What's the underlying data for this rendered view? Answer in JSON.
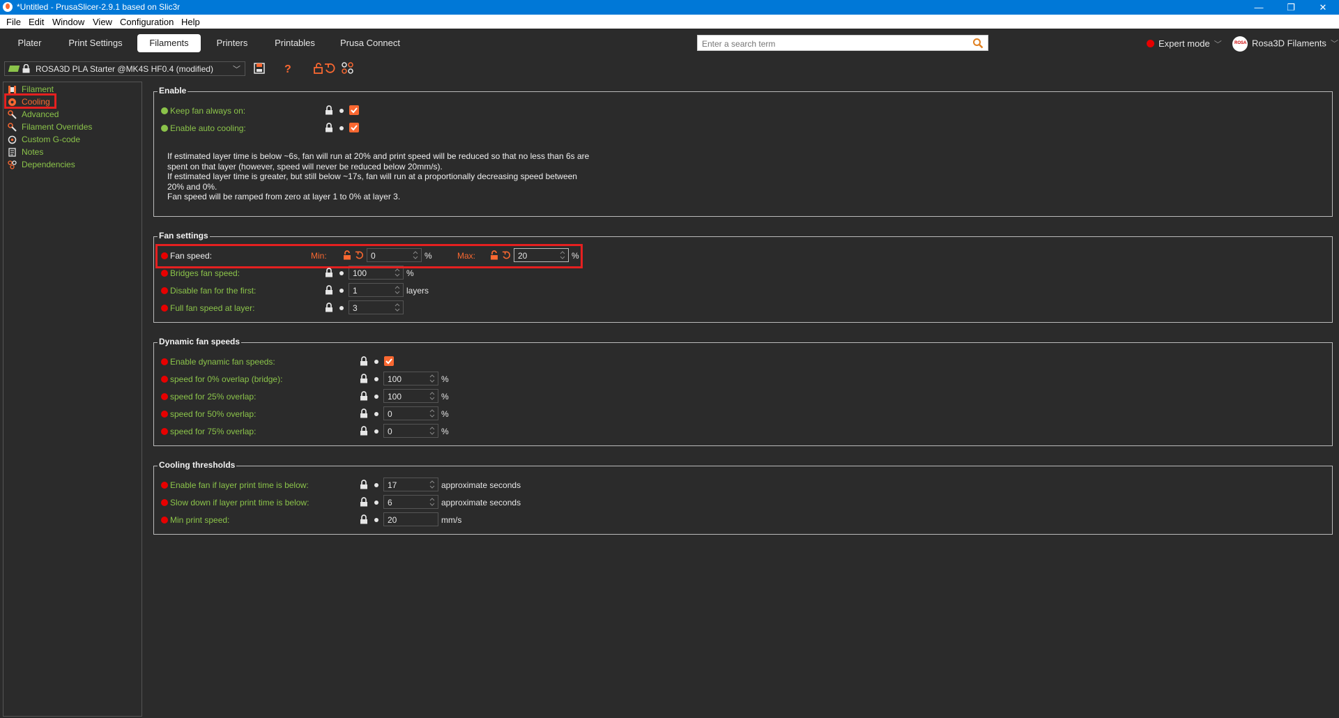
{
  "window": {
    "title": "*Untitled - PrusaSlicer-2.9.1 based on Slic3r",
    "minimize": "—",
    "restore": "❐",
    "close": "✕"
  },
  "menu": [
    "File",
    "Edit",
    "Window",
    "View",
    "Configuration",
    "Help"
  ],
  "tabs": [
    "Plater",
    "Print Settings",
    "Filaments",
    "Printers",
    "Printables",
    "Prusa Connect"
  ],
  "active_tab": "Filaments",
  "search": {
    "placeholder": "Enter a search term",
    "value": ""
  },
  "mode": {
    "label": "Expert mode",
    "color": "#e70000"
  },
  "account": {
    "label": "Rosa3D Filaments"
  },
  "preset": {
    "name": "ROSA3D PLA Starter @MK4S HF0.4 (modified)"
  },
  "sidebar": {
    "items": [
      {
        "label": "Filament",
        "icon": "spool-icon"
      },
      {
        "label": "Cooling",
        "icon": "fan-icon"
      },
      {
        "label": "Advanced",
        "icon": "wrench-icon"
      },
      {
        "label": "Filament Overrides",
        "icon": "wrench-icon"
      },
      {
        "label": "Custom G-code",
        "icon": "gcode-icon"
      },
      {
        "label": "Notes",
        "icon": "notes-icon"
      },
      {
        "label": "Dependencies",
        "icon": "dependencies-icon"
      }
    ],
    "active": "Cooling"
  },
  "groups": {
    "enable": {
      "title": "Enable",
      "keep_fan_label": "Keep fan always on:",
      "auto_cooling_label": "Enable auto cooling:",
      "description": [
        "If estimated layer time is below ~6s, fan will run at 20% and print speed will be reduced so that no less than 6s are",
        "spent on that layer (however, speed will never be reduced below 20mm/s).",
        "If estimated layer time is greater, but still below ~17s, fan will run at a proportionally decreasing speed between",
        "20% and 0%.",
        "Fan speed will be ramped from zero at layer 1 to 0% at layer 3."
      ]
    },
    "fan_settings": {
      "title": "Fan settings",
      "fan_speed_label": "Fan speed:",
      "min_label": "Min:",
      "min_value": "0",
      "max_label": "Max:",
      "max_value": "20",
      "percent": "%",
      "bridges_label": "Bridges fan speed:",
      "bridges_value": "100",
      "disable_first_label": "Disable fan for the first:",
      "disable_first_value": "1",
      "layers_unit": "layers",
      "full_speed_label": "Full fan speed at layer:",
      "full_speed_value": "3"
    },
    "dynamic": {
      "title": "Dynamic fan speeds",
      "enable_label": "Enable dynamic fan speeds:",
      "rows": [
        {
          "label": "speed for 0% overlap (bridge):",
          "value": "100",
          "unit": "%"
        },
        {
          "label": "speed for 25% overlap:",
          "value": "100",
          "unit": "%"
        },
        {
          "label": "speed for 50% overlap:",
          "value": "0",
          "unit": "%"
        },
        {
          "label": "speed for 75% overlap:",
          "value": "0",
          "unit": "%"
        }
      ]
    },
    "thresholds": {
      "title": "Cooling thresholds",
      "rows": [
        {
          "label": "Enable fan if layer print time is below:",
          "value": "17",
          "unit": "approximate seconds"
        },
        {
          "label": "Slow down if layer print time is below:",
          "value": "6",
          "unit": "approximate seconds"
        },
        {
          "label": "Min print speed:",
          "value": "20",
          "unit": "mm/s"
        }
      ]
    }
  },
  "colors": {
    "accent": "#fa6831",
    "label_green": "#8bc34a",
    "status_red": "#e70000",
    "highlight_box": "#e52020"
  }
}
